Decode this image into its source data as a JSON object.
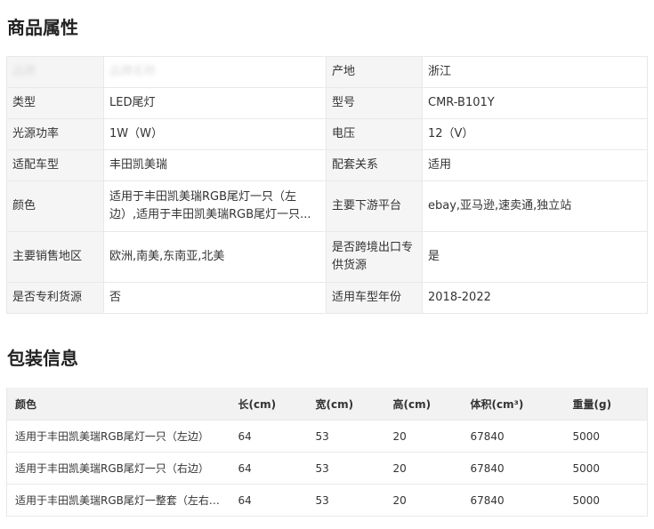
{
  "attributes": {
    "title": "商品属性",
    "rows": [
      {
        "k1": "品牌",
        "v1": "品牌名称",
        "k2": "产地",
        "v2": "浙江"
      },
      {
        "k1": "类型",
        "v1": "LED尾灯",
        "k2": "型号",
        "v2": "CMR-B101Y"
      },
      {
        "k1": "光源功率",
        "v1": "1W（W）",
        "k2": "电压",
        "v2": "12（V）"
      },
      {
        "k1": "适配车型",
        "v1": "丰田凯美瑞",
        "k2": "配套关系",
        "v2": "适用"
      },
      {
        "k1": "颜色",
        "v1": "适用于丰田凯美瑞RGB尾灯一只（左边）,适用于丰田凯美瑞RGB尾灯一只...",
        "k2": "主要下游平台",
        "v2": "ebay,亚马逊,速卖通,独立站"
      },
      {
        "k1": "主要销售地区",
        "v1": "欧洲,南美,东南亚,北美",
        "k2": "是否跨境出口专供货源",
        "v2": "是"
      },
      {
        "k1": "是否专利货源",
        "v1": "否",
        "k2": "适用车型年份",
        "v2": "2018-2022"
      }
    ]
  },
  "packaging": {
    "title": "包装信息",
    "headers": {
      "color": "颜色",
      "length": "长(cm)",
      "width": "宽(cm)",
      "height": "高(cm)",
      "volume": "体积(cm³)",
      "weight": "重量(g)"
    },
    "rows": [
      {
        "color": "适用于丰田凯美瑞RGB尾灯一只（左边）",
        "length": "64",
        "width": "53",
        "height": "20",
        "volume": "67840",
        "weight": "5000"
      },
      {
        "color": "适用于丰田凯美瑞RGB尾灯一只（右边）",
        "length": "64",
        "width": "53",
        "height": "20",
        "volume": "67840",
        "weight": "5000"
      },
      {
        "color": "适用于丰田凯美瑞RGB尾灯一整套（左右两...",
        "length": "64",
        "width": "53",
        "height": "20",
        "volume": "67840",
        "weight": "5000"
      }
    ]
  }
}
